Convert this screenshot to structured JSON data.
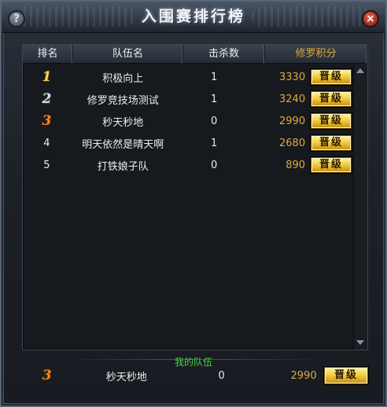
{
  "window": {
    "title": "入围赛排行榜"
  },
  "buttons": {
    "help": "?",
    "close": "×"
  },
  "table": {
    "headers": [
      "排名",
      "队伍名",
      "击杀数",
      "修罗积分"
    ],
    "rows": [
      {
        "rank": "1",
        "name": "积极向上",
        "kills": "1",
        "score": "3330",
        "action": "晋级"
      },
      {
        "rank": "2",
        "name": "修罗竞技场测试",
        "kills": "1",
        "score": "3240",
        "action": "晋级"
      },
      {
        "rank": "3",
        "name": "秒天秒地",
        "kills": "0",
        "score": "2990",
        "action": "晋级"
      },
      {
        "rank": "4",
        "name": "明天依然是晴天啊",
        "kills": "1",
        "score": "2680",
        "action": "晋级"
      },
      {
        "rank": "5",
        "name": "打铁娘子队",
        "kills": "0",
        "score": "890",
        "action": "晋级"
      }
    ]
  },
  "my_team": {
    "label": "我的队伍",
    "rank": "3",
    "name": "秒天秒地",
    "kills": "0",
    "score": "2990",
    "action": "晋级"
  },
  "colors": {
    "score": "#e3a83d",
    "my_team_label": "#46d046",
    "gold_medal": "#f6d25c",
    "silver_medal": "#d8dde5",
    "bronze_medal": "#f08a2a"
  }
}
